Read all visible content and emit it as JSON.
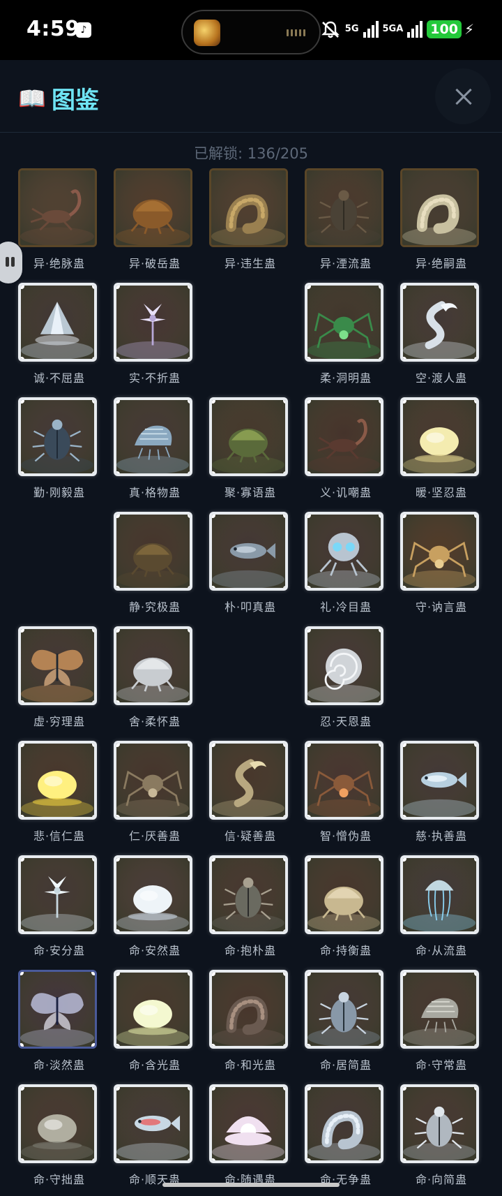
{
  "status_bar": {
    "time": "4:59",
    "network_1": "5G",
    "network_2": "5GA",
    "battery": "100"
  },
  "header": {
    "book_icon": "📖",
    "title": "图鉴",
    "close_icon": "close-icon"
  },
  "unlock_text": "已解锁: 136/205",
  "rows": [
    {
      "cells": [
        {
          "label": "异·绝脉蛊",
          "style": "gold",
          "creature": "scorpion",
          "palette": [
            "#3a3a2c",
            "#6a4a3a",
            "#8a5a4a"
          ]
        },
        {
          "label": "异·破岳蛊",
          "style": "gold",
          "creature": "shell",
          "palette": [
            "#3a3020",
            "#8a5a2a",
            "#b07838"
          ]
        },
        {
          "label": "异·违生蛊",
          "style": "gold",
          "creature": "worm",
          "palette": [
            "#3a3526",
            "#9a8050",
            "#c8a868"
          ]
        },
        {
          "label": "异·湮流蛊",
          "style": "gold",
          "creature": "beetle",
          "palette": [
            "#2e2a22",
            "#4a4236",
            "#6a5a46"
          ]
        },
        {
          "label": "异·绝嗣蛊",
          "style": "gold",
          "creature": "worm",
          "palette": [
            "#26302a",
            "#c8c0a0",
            "#e8dec0"
          ]
        }
      ]
    },
    {
      "cells": [
        {
          "label": "诚·不屈蛊",
          "style": "white",
          "creature": "crystal",
          "palette": [
            "#1a2630",
            "#c8d8e4",
            "#e8f0f8"
          ]
        },
        {
          "label": "实·不折蛊",
          "style": "white",
          "creature": "flower",
          "palette": [
            "#22222e",
            "#b8a8d8",
            "#e8e0f8"
          ]
        },
        {
          "label": "",
          "style": "empty"
        },
        {
          "label": "柔·洞明蛊",
          "style": "white",
          "creature": "spider",
          "palette": [
            "#1c2620",
            "#3a8a4a",
            "#7ce08a"
          ]
        },
        {
          "label": "空·渡人蛊",
          "style": "white",
          "creature": "serpent",
          "palette": [
            "#202a34",
            "#d8e0e8",
            "#f4f8fc"
          ]
        }
      ]
    },
    {
      "cells": [
        {
          "label": "勤·刚毅蛊",
          "style": "white",
          "creature": "beetle",
          "palette": [
            "#1e2834",
            "#3a4a5a",
            "#9ab4c8"
          ]
        },
        {
          "label": "真·格物蛊",
          "style": "white",
          "creature": "shrimp",
          "palette": [
            "#1e2830",
            "#8aa8c0",
            "#c8dce8"
          ]
        },
        {
          "label": "聚·寡语蛊",
          "style": "white",
          "creature": "shell",
          "palette": [
            "#242a20",
            "#5a6a3a",
            "#9ab05a"
          ]
        },
        {
          "label": "义·讥嘲蛊",
          "style": "white",
          "creature": "scorpion",
          "palette": [
            "#26201e",
            "#5a3a30",
            "#8a5a48"
          ]
        },
        {
          "label": "暖·坚忍蛊",
          "style": "white",
          "creature": "blob",
          "palette": [
            "#2a2a26",
            "#d8cc88",
            "#f4ecb0"
          ]
        }
      ]
    },
    {
      "cells": [
        {
          "label": "",
          "style": "empty"
        },
        {
          "label": "静·究极蛊",
          "style": "white",
          "creature": "shell",
          "palette": [
            "#242220",
            "#5a4a30",
            "#8a7040"
          ]
        },
        {
          "label": "朴·叩真蛊",
          "style": "white",
          "creature": "fish",
          "palette": [
            "#1e2630",
            "#8a9aa8",
            "#c8d4e0"
          ]
        },
        {
          "label": "礼·冷目蛊",
          "style": "white",
          "creature": "skull",
          "palette": [
            "#1e2430",
            "#b8c4d0",
            "#7ad8f8"
          ]
        },
        {
          "label": "守·讷言蛊",
          "style": "white",
          "creature": "spider",
          "palette": [
            "#3a2e1a",
            "#c8a060",
            "#e8cc90"
          ]
        }
      ]
    },
    {
      "cells": [
        {
          "label": "虚·穷理蛊",
          "style": "white",
          "creature": "moth",
          "palette": [
            "#1e2630",
            "#c8905a",
            "#e8b888"
          ]
        },
        {
          "label": "舍·柔怀蛊",
          "style": "white",
          "creature": "shell",
          "palette": [
            "#222830",
            "#c8ccd0",
            "#f0f2f4"
          ]
        },
        {
          "label": "",
          "style": "empty"
        },
        {
          "label": "忍·天恩蛊",
          "style": "white",
          "creature": "nautilus",
          "palette": [
            "#202834",
            "#d0d4d8",
            "#f4f6f8"
          ]
        },
        {
          "label": "",
          "style": "empty"
        }
      ]
    },
    {
      "cells": [
        {
          "label": "悲·信仁蛊",
          "style": "white",
          "creature": "blob",
          "palette": [
            "#2a2620",
            "#e8cc40",
            "#fff080"
          ]
        },
        {
          "label": "仁·厌善蛊",
          "style": "white",
          "creature": "spider",
          "palette": [
            "#242220",
            "#8a7a60",
            "#c8b898"
          ]
        },
        {
          "label": "信·疑善蛊",
          "style": "white",
          "creature": "serpent",
          "palette": [
            "#2a2820",
            "#b8a880",
            "#e8dcb0"
          ]
        },
        {
          "label": "智·憎伪蛊",
          "style": "white",
          "creature": "spider",
          "palette": [
            "#2a2226",
            "#8a5a3a",
            "#f0a060"
          ]
        },
        {
          "label": "慈·执善蛊",
          "style": "white",
          "creature": "fish",
          "palette": [
            "#1e2834",
            "#b8d0e0",
            "#eef6fc"
          ]
        }
      ]
    },
    {
      "cells": [
        {
          "label": "命·安分蛊",
          "style": "white",
          "creature": "flower",
          "palette": [
            "#1e2830",
            "#c8d8e0",
            "#f0f8fc"
          ]
        },
        {
          "label": "命·安然蛊",
          "style": "white",
          "creature": "blob",
          "palette": [
            "#2a3038",
            "#c8d4e0",
            "#eef4f8"
          ]
        },
        {
          "label": "命·抱朴蛊",
          "style": "white",
          "creature": "beetle",
          "palette": [
            "#262626",
            "#6a6a60",
            "#a8a090"
          ]
        },
        {
          "label": "命·持衡蛊",
          "style": "white",
          "creature": "shell",
          "palette": [
            "#262420",
            "#c8b890",
            "#ece0c0"
          ]
        },
        {
          "label": "命·从流蛊",
          "style": "white",
          "creature": "jelly",
          "palette": [
            "#1a2a38",
            "#8ad0f0",
            "#d8f4ff"
          ]
        }
      ]
    },
    {
      "cells": [
        {
          "label": "命·淡然蛊",
          "style": "blue",
          "creature": "moth",
          "palette": [
            "#1a2040",
            "#b8bcd8",
            "#e8e8f4"
          ]
        },
        {
          "label": "命·含光蛊",
          "style": "white",
          "creature": "blob",
          "palette": [
            "#242820",
            "#d8e0a0",
            "#f4f8d0"
          ]
        },
        {
          "label": "命·和光蛊",
          "style": "white",
          "creature": "worm",
          "palette": [
            "#2a2420",
            "#6a5a50",
            "#a89080"
          ]
        },
        {
          "label": "命·居简蛊",
          "style": "white",
          "creature": "beetle",
          "palette": [
            "#1e2830",
            "#8898a8",
            "#c8d4e0"
          ]
        },
        {
          "label": "命·守常蛊",
          "style": "white",
          "creature": "shrimp",
          "palette": [
            "#242628",
            "#a8a8a0",
            "#d8d8d0"
          ]
        }
      ]
    },
    {
      "cells": [
        {
          "label": "命·守拙蛊",
          "style": "white",
          "creature": "blob",
          "palette": [
            "#26282a",
            "#7a7a70",
            "#b0aea0"
          ]
        },
        {
          "label": "命·顺天蛊",
          "style": "white",
          "creature": "fish",
          "palette": [
            "#1e2a34",
            "#c8d8e4",
            "#e86060"
          ]
        },
        {
          "label": "命·随遇蛊",
          "style": "white",
          "creature": "pearl",
          "palette": [
            "#28262e",
            "#f0e0f0",
            "#ffffff"
          ]
        },
        {
          "label": "命·无争蛊",
          "style": "white",
          "creature": "worm",
          "palette": [
            "#1e2630",
            "#b8c4d0",
            "#e8f0f8"
          ]
        },
        {
          "label": "命·向简蛊",
          "style": "white",
          "creature": "beetle",
          "palette": [
            "#24282c",
            "#b0b8c0",
            "#e0e6ec"
          ]
        }
      ]
    }
  ]
}
